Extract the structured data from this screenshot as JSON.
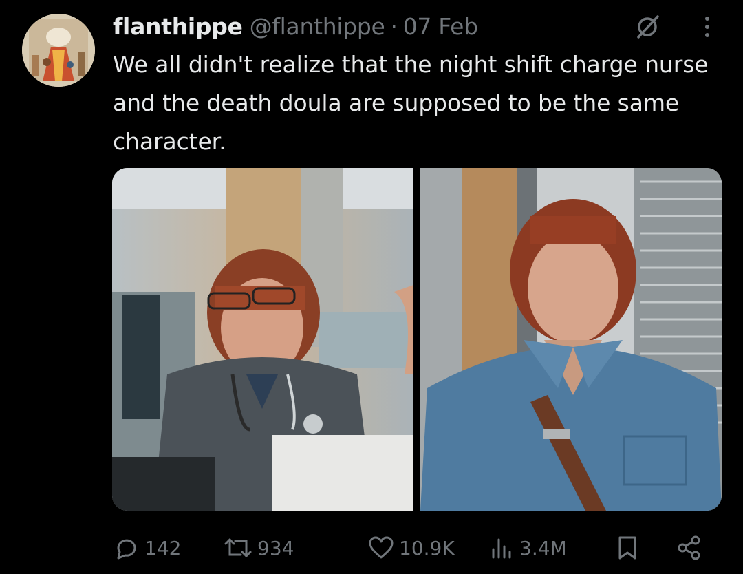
{
  "tweet": {
    "display_name": "flanthippe",
    "handle": "@flanthippe",
    "separator": "·",
    "date": "07 Feb",
    "text": "We all didn't realize that the night shift charge nurse and the death doula are supposed to be the same character.",
    "avatar_icon": "artwork-avatar-icon",
    "grok_icon": "grok-icon",
    "more_icon": "more-options-icon"
  },
  "media": {
    "photos": [
      {
        "subject": "nurse-in-scrubs-photo"
      },
      {
        "subject": "woman-in-denim-shirt-photo"
      }
    ]
  },
  "actions": {
    "replies": "142",
    "reposts": "934",
    "likes": "10.9K",
    "views": "3.4M",
    "icons": [
      "reply-icon",
      "retweet-icon",
      "like-icon",
      "views-icon",
      "bookmark-icon",
      "share-icon"
    ]
  },
  "colors": {
    "background": "#000000",
    "primary_text": "#e7e9ea",
    "secondary_text": "#71767b"
  }
}
